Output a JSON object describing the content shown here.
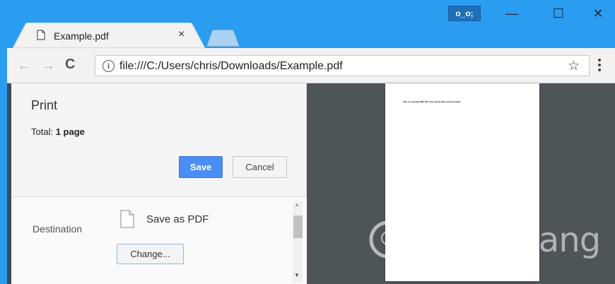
{
  "titlebar": {
    "profile_badge": "o_o;",
    "minimize_label": "—",
    "maximize_label": "☐",
    "close_label": "✕"
  },
  "tab": {
    "title": "Example.pdf",
    "close_label": "×"
  },
  "toolbar": {
    "back_label": "←",
    "forward_label": "→",
    "reload_label": "C",
    "url": "file:///C:/Users/chris/Downloads/Example.pdf",
    "info_label": "i",
    "star_label": "☆"
  },
  "print_dialog": {
    "title": "Print",
    "total_label": "Total:",
    "total_value": "1 page",
    "save_label": "Save",
    "cancel_label": "Cancel",
    "destination_label": "Destination",
    "destination_value": "Save as PDF",
    "change_label": "Change..."
  },
  "preview": {
    "page_text": "This is a sample PDF file to be saved with a print preview"
  },
  "watermark": {
    "text": "uantrimang"
  },
  "colors": {
    "titlebar": "#2a9df1",
    "save_button": "#4a8df5",
    "preview_bg": "#4f5457"
  }
}
